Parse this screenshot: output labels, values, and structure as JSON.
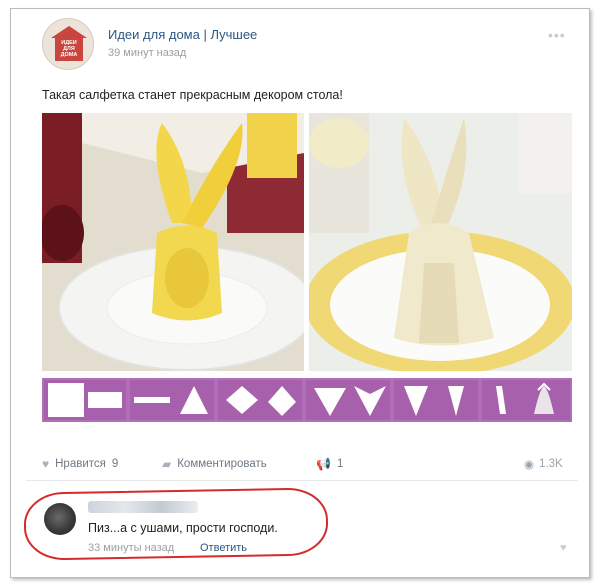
{
  "post": {
    "group_name": "Идеи для дома | Лучшее",
    "time": "39 минут назад",
    "text": "Такая салфетка станет прекрасным декором стола!",
    "logo_text": "ИДЕИ ДЛЯ ДОМА"
  },
  "actions": {
    "like_label": "Нравится",
    "like_count": "9",
    "comment_label": "Комментировать",
    "share_count": "1",
    "views": "1.3K"
  },
  "comment": {
    "text": "Пиз...а с ушами, прости господи.",
    "time": "33 минуты назад",
    "reply_label": "Ответить"
  },
  "colors": {
    "link": "#2a5885",
    "steps_bg": "#b06fb6",
    "highlight": "#d42b2b",
    "napkin_yellow": "#f2d84e",
    "napkin_cream": "#efe6c6"
  },
  "icons": [
    "more-icon",
    "heart-icon",
    "comment-icon",
    "share-icon",
    "eye-icon",
    "comment-heart-icon"
  ]
}
